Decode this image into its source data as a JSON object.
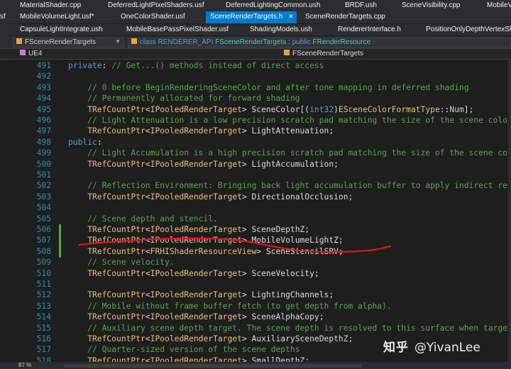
{
  "tabs_row1": [
    "MaterialShader.cpp",
    "DeferredLightPixelShaders.usf",
    "DeferredLightingCommon.ush",
    "BRDF.ush",
    "SceneVisibility.cpp",
    "MobileVi"
  ],
  "tabs_row2": {
    "left_fragment": "sf",
    "items": [
      "MobileVolumeLight.usf*",
      "OneColorShader.usf",
      "SceneRenderTargets.h",
      "SceneRenderTargets.cpp"
    ],
    "active_index": 2
  },
  "tabs_row3": [
    "CapsuleLightIntegrate.ush",
    "MobileBasePassPixelShader.usf",
    "ShadingModels.ush",
    "RendererInterface.h",
    "PositionOnlyDepthVertexSha"
  ],
  "navbar": {
    "scope_left": "FSceneRenderTargets",
    "scope_right_kw": "class",
    "scope_right_macro": "RENDERER_API",
    "scope_right_class": "FSceneRenderTargets",
    "scope_right_sep": " : ",
    "scope_right_access": "public",
    "scope_right_base": "FRenderResource"
  },
  "scopebar": {
    "project": "UE4",
    "member": "FSceneRenderTargets"
  },
  "code_lines": [
    {
      "n": "491",
      "t": [
        [
          "kw",
          "private"
        ],
        [
          "pl",
          ": "
        ],
        [
          "cm",
          "// Get...() methods instead of direct access"
        ]
      ]
    },
    {
      "n": "492",
      "t": []
    },
    {
      "n": "493",
      "t": [
        [
          "pl",
          "    "
        ],
        [
          "cm",
          "// 0 before BeginRenderingSceneColor and after tone mapping in deferred shading"
        ]
      ]
    },
    {
      "n": "494",
      "t": [
        [
          "pl",
          "    "
        ],
        [
          "cm",
          "// Permanently allocated for forward shading"
        ]
      ]
    },
    {
      "n": "495",
      "t": [
        [
          "pl",
          "    "
        ],
        [
          "tp",
          "TRefCountPtr"
        ],
        [
          "pl",
          "<"
        ],
        [
          "tp",
          "IPooledRenderTarget"
        ],
        [
          "pl",
          "> SceneColor[("
        ],
        [
          "kw",
          "int32"
        ],
        [
          "pl",
          ")"
        ],
        [
          "tp",
          "ESceneColorFormatType"
        ],
        [
          "pl",
          "::"
        ],
        [
          "en",
          "Num"
        ],
        [
          "pl",
          "];"
        ]
      ]
    },
    {
      "n": "496",
      "t": [
        [
          "pl",
          "    "
        ],
        [
          "cm",
          "// Light Attenuation is a low precision scratch pad matching the size of the scene color"
        ]
      ]
    },
    {
      "n": "497",
      "t": [
        [
          "pl",
          "    "
        ],
        [
          "tp",
          "TRefCountPtr"
        ],
        [
          "pl",
          "<"
        ],
        [
          "tp",
          "IPooledRenderTarget"
        ],
        [
          "pl",
          "> LightAttenuation;"
        ]
      ]
    },
    {
      "n": "498",
      "t": [
        [
          "kw",
          "public"
        ],
        [
          "pl",
          ":"
        ]
      ]
    },
    {
      "n": "499",
      "t": [
        [
          "pl",
          "    "
        ],
        [
          "cm",
          "// Light Accumulation is a high precision scratch pad matching the size of the scene colo"
        ]
      ]
    },
    {
      "n": "500",
      "t": [
        [
          "pl",
          "    "
        ],
        [
          "tp",
          "TRefCountPtr"
        ],
        [
          "pl",
          "<"
        ],
        [
          "tp",
          "IPooledRenderTarget"
        ],
        [
          "pl",
          "> LightAccumulation;"
        ]
      ]
    },
    {
      "n": "501",
      "t": []
    },
    {
      "n": "502",
      "t": [
        [
          "pl",
          "    "
        ],
        [
          "cm",
          "// Reflection Environment: Bringing back light accumulation buffer to apply indirect refl"
        ]
      ]
    },
    {
      "n": "503",
      "t": [
        [
          "pl",
          "    "
        ],
        [
          "tp",
          "TRefCountPtr"
        ],
        [
          "pl",
          "<"
        ],
        [
          "tp",
          "IPooledRenderTarget"
        ],
        [
          "pl",
          "> DirectionalOcclusion;"
        ]
      ]
    },
    {
      "n": "504",
      "t": []
    },
    {
      "n": "505",
      "t": [
        [
          "pl",
          "    "
        ],
        [
          "cm",
          "// Scene depth and stencil."
        ]
      ]
    },
    {
      "n": "506",
      "t": [
        [
          "pl",
          "    "
        ],
        [
          "tp",
          "TRefCountPtr"
        ],
        [
          "pl",
          "<"
        ],
        [
          "tp",
          "IPooledRenderTarget"
        ],
        [
          "pl",
          "> SceneDepthZ;"
        ]
      ]
    },
    {
      "n": "507",
      "t": [
        [
          "pl",
          "    "
        ],
        [
          "tp",
          "TRefCountPtr"
        ],
        [
          "pl",
          "<"
        ],
        [
          "tp",
          "IPooledRenderTarget"
        ],
        [
          "pl",
          "> MobileVolumeLightZ;"
        ]
      ]
    },
    {
      "n": "508",
      "t": [
        [
          "pl",
          "    "
        ],
        [
          "tp",
          "TRefCountPtr"
        ],
        [
          "pl",
          "<"
        ],
        [
          "tp",
          "FRHIShaderResourceView"
        ],
        [
          "pl",
          "> SceneStencilSRV;"
        ]
      ]
    },
    {
      "n": "509",
      "t": [
        [
          "pl",
          "    "
        ],
        [
          "cm",
          "// Scene velocity."
        ]
      ]
    },
    {
      "n": "510",
      "t": [
        [
          "pl",
          "    "
        ],
        [
          "tp",
          "TRefCountPtr"
        ],
        [
          "pl",
          "<"
        ],
        [
          "tp",
          "IPooledRenderTarget"
        ],
        [
          "pl",
          "> SceneVelocity;"
        ]
      ]
    },
    {
      "n": "511",
      "t": []
    },
    {
      "n": "512",
      "t": [
        [
          "pl",
          "    "
        ],
        [
          "tp",
          "TRefCountPtr"
        ],
        [
          "pl",
          "<"
        ],
        [
          "tp",
          "IPooledRenderTarget"
        ],
        [
          "pl",
          "> LightingChannels;"
        ]
      ]
    },
    {
      "n": "513",
      "t": [
        [
          "pl",
          "    "
        ],
        [
          "cm",
          "// Mobile without frame buffer fetch (to get depth from alpha)."
        ]
      ]
    },
    {
      "n": "514",
      "t": [
        [
          "pl",
          "    "
        ],
        [
          "tp",
          "TRefCountPtr"
        ],
        [
          "pl",
          "<"
        ],
        [
          "tp",
          "IPooledRenderTarget"
        ],
        [
          "pl",
          "> SceneAlphaCopy;"
        ]
      ]
    },
    {
      "n": "515",
      "t": [
        [
          "pl",
          "    "
        ],
        [
          "cm",
          "// Auxiliary scene depth target. The scene depth is resolved to this surface when targeti"
        ]
      ]
    },
    {
      "n": "516",
      "t": [
        [
          "pl",
          "    "
        ],
        [
          "tp",
          "TRefCountPtr"
        ],
        [
          "pl",
          "<"
        ],
        [
          "tp",
          "IPooledRenderTarget"
        ],
        [
          "pl",
          "> AuxiliarySceneDepthZ;"
        ]
      ]
    },
    {
      "n": "517",
      "t": [
        [
          "pl",
          "    "
        ],
        [
          "cm",
          "// Quarter-sized version of the scene depths"
        ]
      ]
    },
    {
      "n": "518",
      "t": [
        [
          "pl",
          "    "
        ],
        [
          "tp",
          "TRefCountPtr"
        ],
        [
          "pl",
          "<"
        ],
        [
          "tp",
          "IPooledRenderTarget"
        ],
        [
          "pl",
          "> SmallDepthZ;"
        ]
      ]
    }
  ],
  "status": {
    "zoom": "87 %"
  },
  "watermark": {
    "site": "知乎",
    "handle": "@YivanLee"
  },
  "colors": {
    "accent_tab": "#007acc",
    "annotation_red": "#e0141e",
    "change_bar": "#57a64a"
  }
}
